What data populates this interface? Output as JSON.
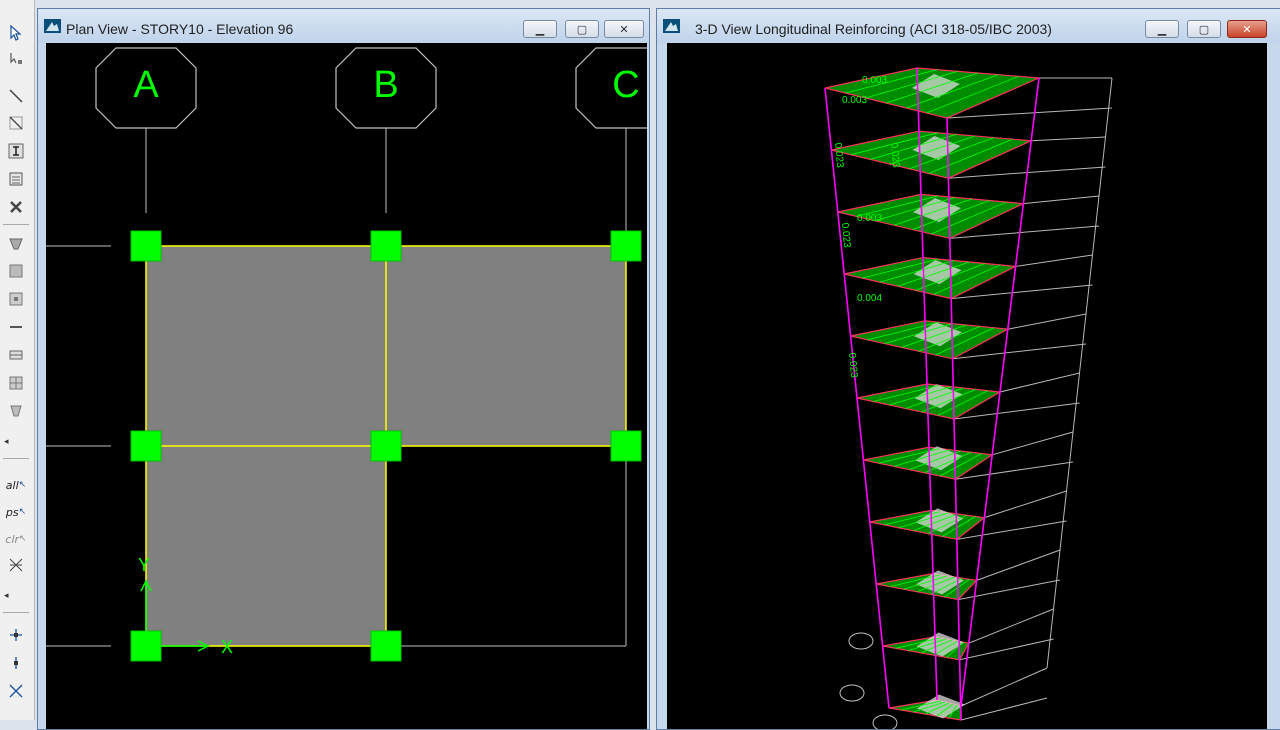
{
  "toolbar": {
    "all_label": "all",
    "ps_label": "ps",
    "clr_label": "clr"
  },
  "plan_window": {
    "title": "Plan View - STORY10 - Elevation 96",
    "grid_labels": [
      "A",
      "B",
      "C"
    ],
    "axis_x": "X",
    "axis_y": "Y"
  },
  "view3d_window": {
    "title": "3-D View  Longitudinal Reinforcing  (ACI 318-05/IBC 2003)",
    "values": [
      "0.023",
      "0.003",
      "0.004"
    ]
  },
  "colors": {
    "window_title_bg": "#c6d7ee",
    "canvas_bg": "#000000",
    "slab_fill": "#808080",
    "beam_line": "#ffff00",
    "column_node": "#00ff00",
    "frame_pink": "#ff00ff",
    "grid_line": "#c0c0c0",
    "close_button_active": "#c8432a"
  },
  "icons": [
    "pointer-icon",
    "reshape-icon",
    "draw-line-icon",
    "draw-brace-icon",
    "draw-column-icon",
    "draw-area-icon",
    "delete-icon",
    "draw-wall-icon",
    "draw-rectangle-icon",
    "draw-region-icon",
    "link-icon",
    "select-all-icon",
    "select-previous-icon",
    "clear-selection-icon",
    "intersect-icon",
    "snap-point-icon",
    "snap-end-icon",
    "snap-intersection-icon"
  ]
}
